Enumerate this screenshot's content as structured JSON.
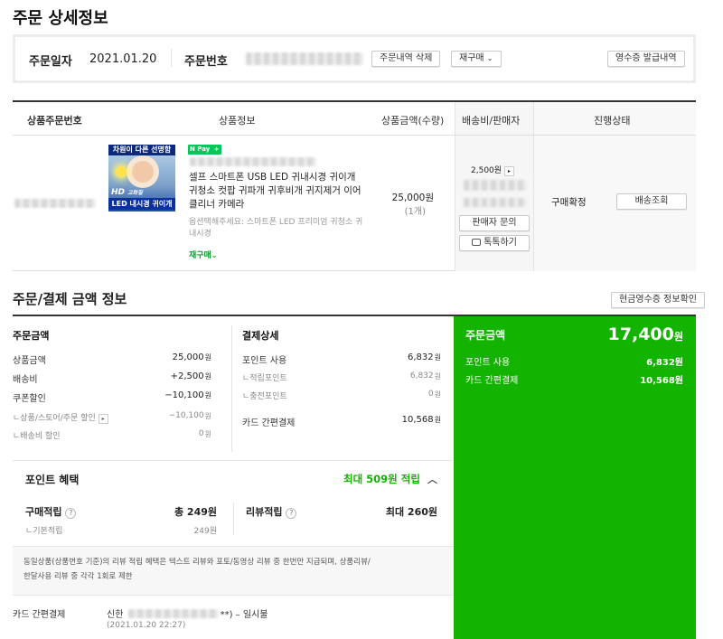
{
  "page_title": "주문 상세정보",
  "order": {
    "date_label": "주문일자",
    "date_value": "2021.01.20",
    "number_label": "주문번호",
    "delete_button": "주문내역 삭제",
    "rebuy_button": "재구매",
    "receipt_button": "영수증 발급내역"
  },
  "items_table": {
    "headers": [
      "상품주문번호",
      "상품정보",
      "상품금액(수량)",
      "배송비/판매자",
      "진행상태"
    ],
    "item": {
      "thumb_top": "차원이 다른 선명함",
      "thumb_hd": "HD",
      "thumb_hd_sub": "고화질",
      "thumb_bottom": "LED 내시경 귀이개",
      "npay": "N Pay",
      "npay_plus": "+",
      "name": "셀프 스마트폰 USB LED 귀내시경 귀이개 귀청소 컷팝 귀파개 귀후비개 귀지제거 이어클리너 카메라",
      "option": "옵션택해주세요: 스마트폰 LED 프리미엄 귀청소 귀내시경",
      "rebuy_link": "재구매",
      "price": "25,000원",
      "qty": "(1개)",
      "shipping": "2,500원",
      "seller_inquiry": "판매자 문의",
      "talk": "톡톡하기",
      "status": "구매확정",
      "track_button": "배송조회"
    }
  },
  "payment": {
    "title": "주문/결제 금액 정보",
    "cash_receipt_button": "현금영수증 정보확인",
    "order_amount": {
      "title": "주문금액",
      "rows": [
        {
          "label": "상품금액",
          "value": "25,000"
        },
        {
          "label": "배송비",
          "value": "+2,500"
        },
        {
          "label": "쿠폰할인",
          "value": "−10,100"
        }
      ],
      "sub_rows": [
        {
          "label": "ㄴ상품/스토어/주문 할인",
          "value": "−10,100"
        },
        {
          "label": "ㄴ배송비 할인",
          "value": "0"
        }
      ]
    },
    "pay_detail": {
      "title": "결제상세",
      "point_label": "포인트 사용",
      "point_value": "6,832",
      "sub_rows": [
        {
          "label": "ㄴ적립포인트",
          "value": "6,832"
        },
        {
          "label": "ㄴ충전포인트",
          "value": "0"
        }
      ],
      "card_label": "카드 간편결제",
      "card_value": "10,568"
    },
    "won": "원",
    "green": {
      "label": "주문금액",
      "total": "17,400",
      "rows": [
        {
          "label": "포인트 사용",
          "value": "6,832원"
        },
        {
          "label": "카드 간편결제",
          "value": "10,568원"
        }
      ]
    },
    "benefit": {
      "title": "포인트 혜택",
      "max": "최대 509원 적립",
      "buy_label": "구매적립",
      "buy_value": "총 249원",
      "basic_label": "ㄴ기본적립",
      "basic_value": "249원",
      "review_label": "리뷰적립",
      "review_value": "최대 260원",
      "notice_line1": "동일상품(상품번호 기준)의 리뷰 적립 혜택은 텍스트 리뷰와 포토/동영상 리뷰 중 한번만 지급되며, 상품리뷰/",
      "notice_line2": "한달사용 리뷰 중 각각 1회로 제한"
    },
    "card_footer": {
      "label": "카드 간편결제",
      "issuer": "신한",
      "suffix": "**) – 일시불",
      "time": "(2021.01.20 22:27)"
    }
  },
  "colors": {
    "green": "#12b400",
    "naver_green": "#03c75a"
  }
}
